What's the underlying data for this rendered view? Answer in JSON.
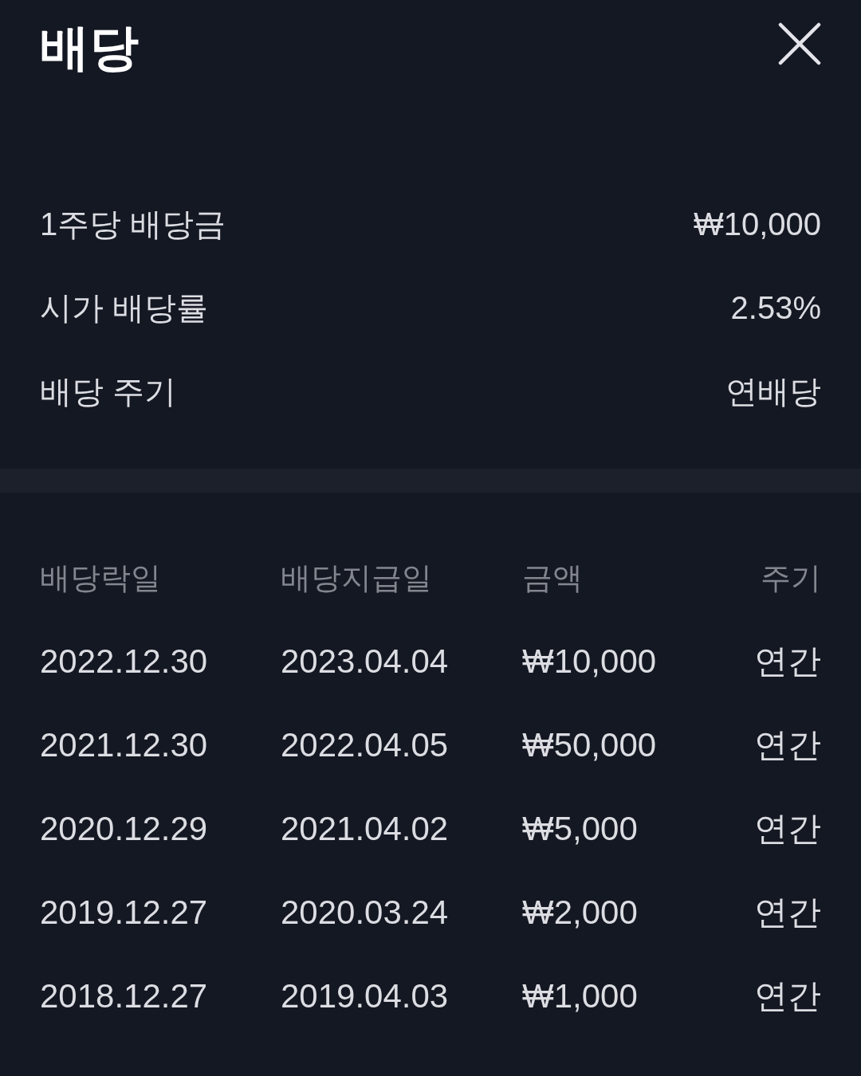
{
  "title": "배당",
  "summary": [
    {
      "label": "1주당 배당금",
      "value": "₩10,000"
    },
    {
      "label": "시가 배당률",
      "value": "2.53%"
    },
    {
      "label": "배당 주기",
      "value": "연배당"
    }
  ],
  "table": {
    "columns": [
      "배당락일",
      "배당지급일",
      "금액",
      "주기"
    ],
    "rows": [
      [
        "2022.12.30",
        "2023.04.04",
        "₩10,000",
        "연간"
      ],
      [
        "2021.12.30",
        "2022.04.05",
        "₩50,000",
        "연간"
      ],
      [
        "2020.12.29",
        "2021.04.02",
        "₩5,000",
        "연간"
      ],
      [
        "2019.12.27",
        "2020.03.24",
        "₩2,000",
        "연간"
      ],
      [
        "2018.12.27",
        "2019.04.03",
        "₩1,000",
        "연간"
      ]
    ]
  }
}
